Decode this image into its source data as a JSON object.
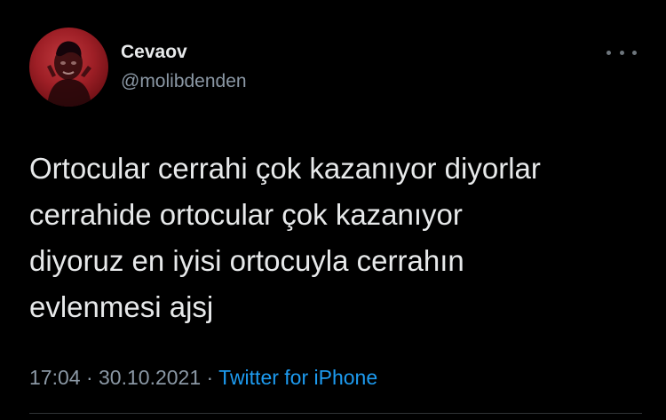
{
  "user": {
    "display_name": "Cevaov",
    "handle": "@molibdenden"
  },
  "tweet": {
    "lines": [
      "Ortocular cerrahi çok kazanıyor diyorlar",
      "cerrahide ortocular çok kazanıyor",
      "diyoruz en iyisi ortocuyla cerrahın",
      "evlenmesi ajsj"
    ]
  },
  "meta": {
    "time": "17:04",
    "separator_1": " · ",
    "date": "30.10.2021",
    "separator_2": " · ",
    "source": "Twitter for iPhone"
  },
  "icons": {
    "more": "more-horizontal-icon"
  },
  "colors": {
    "background": "#000000",
    "text": "#e7e9ea",
    "secondary": "#8b98a5",
    "link": "#1d9bf0",
    "avatar": "#9e1f26"
  }
}
